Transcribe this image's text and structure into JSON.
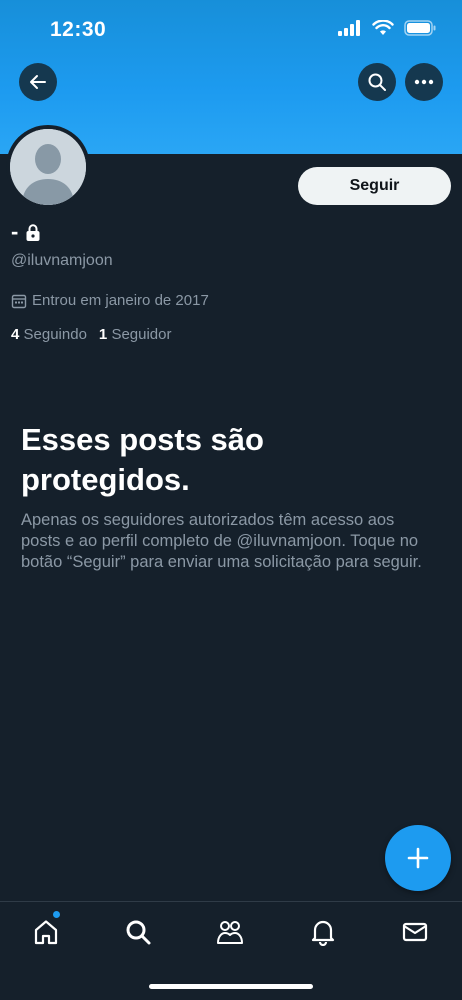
{
  "status_bar": {
    "time": "12:30"
  },
  "profile": {
    "display_name": "-",
    "handle": "@iluvnamjoon",
    "joined": "Entrou em janeiro de 2017",
    "following_count": "4",
    "following_label": "Seguindo",
    "followers_count": "1",
    "followers_label": "Seguidor",
    "follow_button": "Seguir"
  },
  "protected": {
    "title": "Esses posts são protegidos.",
    "description": "Apenas os seguidores autorizados têm acesso aos posts e ao perfil completo de @iluvnamjoon. Toque no botão “Seguir” para enviar uma solicitação para seguir."
  },
  "tabs": [
    "home-icon",
    "search-icon",
    "communities-icon",
    "notifications-icon",
    "messages-icon"
  ],
  "colors": {
    "accent": "#1d9bf0",
    "background": "#15202b",
    "secondary_text": "#8b98a5"
  }
}
